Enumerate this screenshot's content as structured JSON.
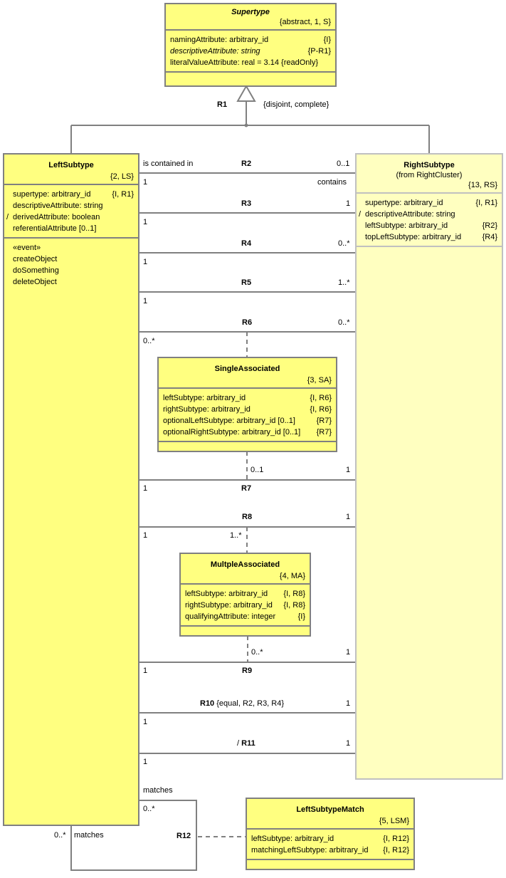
{
  "classes": {
    "supertype": {
      "name": "Supertype",
      "keyletters": "{abstract, 1, S}",
      "attributes": [
        {
          "derived": "",
          "text": "namingAttribute: arbitrary_id",
          "constraint": "{I}",
          "italic": false
        },
        {
          "derived": "",
          "text": "descriptiveAttribute: string",
          "constraint": "{P-R1}",
          "italic": true
        },
        {
          "derived": "",
          "text": "literalValueAttribute: real = 3.14 {readOnly}",
          "constraint": "",
          "italic": false
        }
      ]
    },
    "left_subtype": {
      "name": "LeftSubtype",
      "keyletters": "{2, LS}",
      "attributes": [
        {
          "derived": "",
          "text": "supertype: arbitrary_id",
          "constraint": "{I, R1}"
        },
        {
          "derived": "",
          "text": "descriptiveAttribute: string",
          "constraint": ""
        },
        {
          "derived": "/",
          "text": "derivedAttribute: boolean",
          "constraint": ""
        },
        {
          "derived": "",
          "text": "referentialAttribute [0..1]",
          "constraint": ""
        }
      ],
      "operations": [
        "«event»",
        "createObject",
        "doSomething",
        "deleteObject"
      ]
    },
    "right_subtype": {
      "name": "RightSubtype",
      "from": "(from RightCluster)",
      "keyletters": "{13, RS}",
      "attributes": [
        {
          "derived": "",
          "text": "supertype: arbitrary_id",
          "constraint": "{I, R1}"
        },
        {
          "derived": "/",
          "text": "descriptiveAttribute: string",
          "constraint": ""
        },
        {
          "derived": "",
          "text": "leftSubtype: arbitrary_id",
          "constraint": "{R2}"
        },
        {
          "derived": "",
          "text": "topLeftSubtype: arbitrary_id",
          "constraint": "{R4}"
        }
      ]
    },
    "single_associated": {
      "name": "SingleAssociated",
      "keyletters": "{3, SA}",
      "attributes": [
        {
          "derived": "",
          "text": "leftSubtype: arbitrary_id",
          "constraint": "{I, R6}"
        },
        {
          "derived": "",
          "text": "rightSubtype: arbitrary_id",
          "constraint": "{I, R6}"
        },
        {
          "derived": "",
          "text": "optionalLeftSubtype: arbitrary_id [0..1]",
          "constraint": "{R7}"
        },
        {
          "derived": "",
          "text": "optionalRightSubtype: arbitrary_id [0..1]",
          "constraint": "{R7}"
        }
      ]
    },
    "multiple_associated": {
      "name": "MultpleAssociated",
      "keyletters": "{4, MA}",
      "attributes": [
        {
          "derived": "",
          "text": "leftSubtype: arbitrary_id",
          "constraint": "{I, R8}"
        },
        {
          "derived": "",
          "text": "rightSubtype: arbitrary_id",
          "constraint": "{I, R8}"
        },
        {
          "derived": "",
          "text": "qualifyingAttribute: integer",
          "constraint": "{I}"
        }
      ]
    },
    "left_subtype_match": {
      "name": "LeftSubtypeMatch",
      "keyletters": "{5, LSM}",
      "attributes": [
        {
          "derived": "",
          "text": "leftSubtype: arbitrary_id",
          "constraint": "{I, R12}"
        },
        {
          "derived": "",
          "text": "matchingLeftSubtype: arbitrary_id",
          "constraint": "{I, R12}"
        }
      ]
    }
  },
  "relationships": {
    "r1": {
      "name": "R1",
      "constraint": "{disjoint, complete}"
    },
    "r2": {
      "name": "R2",
      "left_phrase": "is contained in",
      "right_mult": "0..1",
      "left_mult": "1",
      "right_phrase": "contains"
    },
    "r3": {
      "name": "R3",
      "right_mult": "1",
      "left_mult": "1"
    },
    "r4": {
      "name": "R4",
      "right_mult": "0..*",
      "left_mult": "1"
    },
    "r5": {
      "name": "R5",
      "right_mult": "1..*",
      "left_mult": "1"
    },
    "r6": {
      "name": "R6",
      "right_mult": "0..*",
      "left_mult": "0..*"
    },
    "r7": {
      "name": "R7",
      "assoc_mult": "0..1",
      "right_mult": "1",
      "left_mult": "1"
    },
    "r8": {
      "name": "R8",
      "right_mult": "1",
      "left_mult": "1",
      "assoc_mult": "1..*"
    },
    "r9": {
      "name": "R9",
      "assoc_mult": "0..*",
      "right_mult": "1",
      "left_mult": "1"
    },
    "r10": {
      "name": "R10",
      "constraint": "{equal, R2, R3, R4}",
      "right_mult": "1",
      "left_mult": "1"
    },
    "r11": {
      "derived": "/",
      "name": "R11",
      "right_mult": "1",
      "left_mult": "1"
    },
    "r12": {
      "name": "R12",
      "top_phrase": "matches",
      "top_mult": "0..*",
      "bottom_phrase": "matches",
      "bottom_mult": "0..*"
    }
  }
}
